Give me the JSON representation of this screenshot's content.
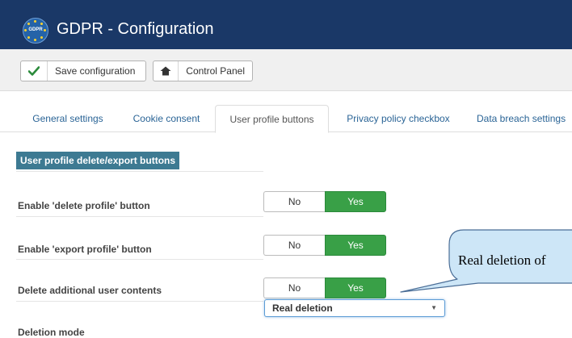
{
  "header": {
    "title": "GDPR - Configuration",
    "logo_text": "GDPR",
    "background_color": "#1a3867"
  },
  "toolbar": {
    "save_label": "Save configuration",
    "save_icon": "checkmark-icon",
    "control_panel_label": "Control Panel",
    "control_panel_icon": "home-icon"
  },
  "tabs": [
    {
      "label": "General settings",
      "active": false
    },
    {
      "label": "Cookie consent",
      "active": false
    },
    {
      "label": "User profile buttons",
      "active": true
    },
    {
      "label": "Privacy policy checkbox",
      "active": false
    },
    {
      "label": "Data breach settings",
      "active": false
    }
  ],
  "section": {
    "heading": "User profile delete/export buttons"
  },
  "settings": [
    {
      "label": "Enable 'delete profile' button",
      "no": "No",
      "yes": "Yes",
      "value": "Yes"
    },
    {
      "label": "Enable 'export profile' button",
      "no": "No",
      "yes": "Yes",
      "value": "Yes"
    },
    {
      "label": "Delete additional user contents",
      "no": "No",
      "yes": "Yes",
      "value": "Yes"
    }
  ],
  "deletion_mode": {
    "label": "Deletion mode",
    "selected": "Real deletion"
  },
  "callout": {
    "text": "Real deletion of"
  },
  "colors": {
    "yes_active": "#39a047",
    "link": "#2a6496",
    "section_heading": "#3d7a92",
    "callout_fill": "#cde6f7"
  }
}
